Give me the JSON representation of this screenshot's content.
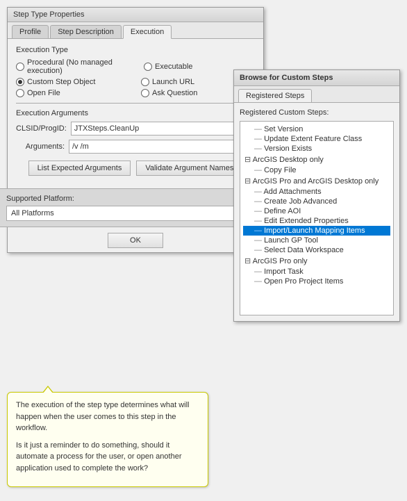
{
  "mainDialog": {
    "title": "Step Type Properties",
    "tabs": [
      {
        "label": "Profile",
        "active": false
      },
      {
        "label": "Step Description",
        "active": false
      },
      {
        "label": "Execution",
        "active": true
      }
    ],
    "executionType": {
      "label": "Execution Type",
      "options": [
        {
          "label": "Procedural (No managed execution)",
          "checked": false,
          "col": 0
        },
        {
          "label": "Executable",
          "checked": false,
          "col": 1
        },
        {
          "label": "Custom Step Object",
          "checked": true,
          "col": 0
        },
        {
          "label": "Launch URL",
          "checked": false,
          "col": 1
        },
        {
          "label": "Open File",
          "checked": false,
          "col": 0
        },
        {
          "label": "Ask Question",
          "checked": false,
          "col": 1
        }
      ]
    },
    "executionArguments": {
      "label": "Execution Arguments",
      "clsidLabel": "CLSID/ProgID:",
      "clsidValue": "JTXSteps.CleanUp",
      "argumentsLabel": "Arguments:",
      "argumentsValue": "/v /m",
      "listExpectedBtn": "List Expected Arguments",
      "validateBtn": "Validate Argument Names"
    },
    "supportedPlatform": {
      "label": "Supported Platform:",
      "value": "All Platforms",
      "options": [
        "All Platforms",
        "ArcGIS Pro only",
        "ArcGIS Desktop only"
      ]
    },
    "okButton": "OK"
  },
  "callout": {
    "text1": "The execution of the step type determines what will happen when the user comes to this step in the workflow.",
    "text2": "Is it just a reminder to do something, should it automate a process for the user, or open another application used to complete the work?"
  },
  "browseDialog": {
    "title": "Browse for Custom Steps",
    "tab": "Registered Steps",
    "sectionLabel": "Registered Custom Steps:",
    "items": [
      {
        "label": "Set Version",
        "type": "child",
        "selected": false
      },
      {
        "label": "Update Extent Feature Class",
        "type": "child",
        "selected": false
      },
      {
        "label": "Version Exists",
        "type": "child",
        "selected": false
      },
      {
        "label": "ArcGIS Desktop only",
        "type": "group",
        "selected": false
      },
      {
        "label": "Copy File",
        "type": "child",
        "selected": false
      },
      {
        "label": "ArcGIS Pro and ArcGIS Desktop only",
        "type": "group",
        "selected": false
      },
      {
        "label": "Add Attachments",
        "type": "child",
        "selected": false
      },
      {
        "label": "Create Job Advanced",
        "type": "child",
        "selected": false
      },
      {
        "label": "Define AOI",
        "type": "child",
        "selected": false
      },
      {
        "label": "Edit Extended Properties",
        "type": "child",
        "selected": false
      },
      {
        "label": "Import/Launch Mapping Items",
        "type": "child",
        "selected": true
      },
      {
        "label": "Launch GP Tool",
        "type": "child",
        "selected": false
      },
      {
        "label": "Select Data Workspace",
        "type": "child",
        "selected": false
      },
      {
        "label": "ArcGIS Pro only",
        "type": "group",
        "selected": false
      },
      {
        "label": "Import Task",
        "type": "child",
        "selected": false
      },
      {
        "label": "Open Pro Project Items",
        "type": "child",
        "selected": false
      }
    ]
  }
}
